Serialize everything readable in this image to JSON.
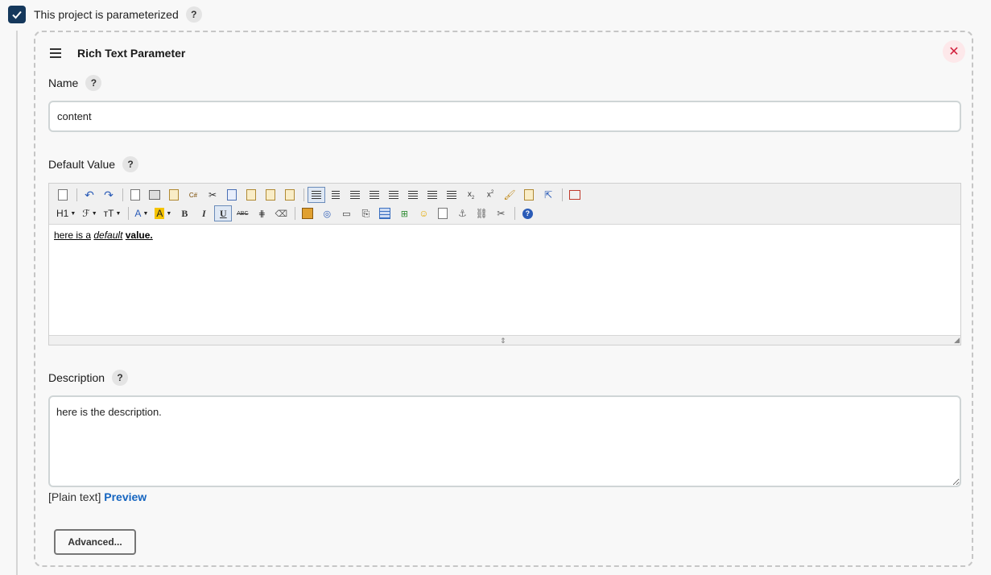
{
  "parameterized": {
    "label": "This project is parameterized",
    "checked": true,
    "help": "?"
  },
  "parameter": {
    "title": "Rich Text Parameter",
    "delete_icon": "close-icon",
    "name": {
      "label": "Name",
      "help": "?",
      "value": "content"
    },
    "default_value": {
      "label": "Default Value",
      "help": "?",
      "content": {
        "part1": "here is a",
        "part2": "default",
        "part3": "value."
      },
      "toolbar": {
        "heading": "H1",
        "font": "ℱ",
        "size": "тT"
      }
    },
    "description": {
      "label": "Description",
      "help": "?",
      "value": "here is the description.",
      "format_text": "[Plain text]",
      "preview_label": "Preview"
    },
    "advanced_label": "Advanced..."
  },
  "colors": {
    "checkbox": "#15385c",
    "link": "#1565c0",
    "delete": "#d21f3c"
  }
}
